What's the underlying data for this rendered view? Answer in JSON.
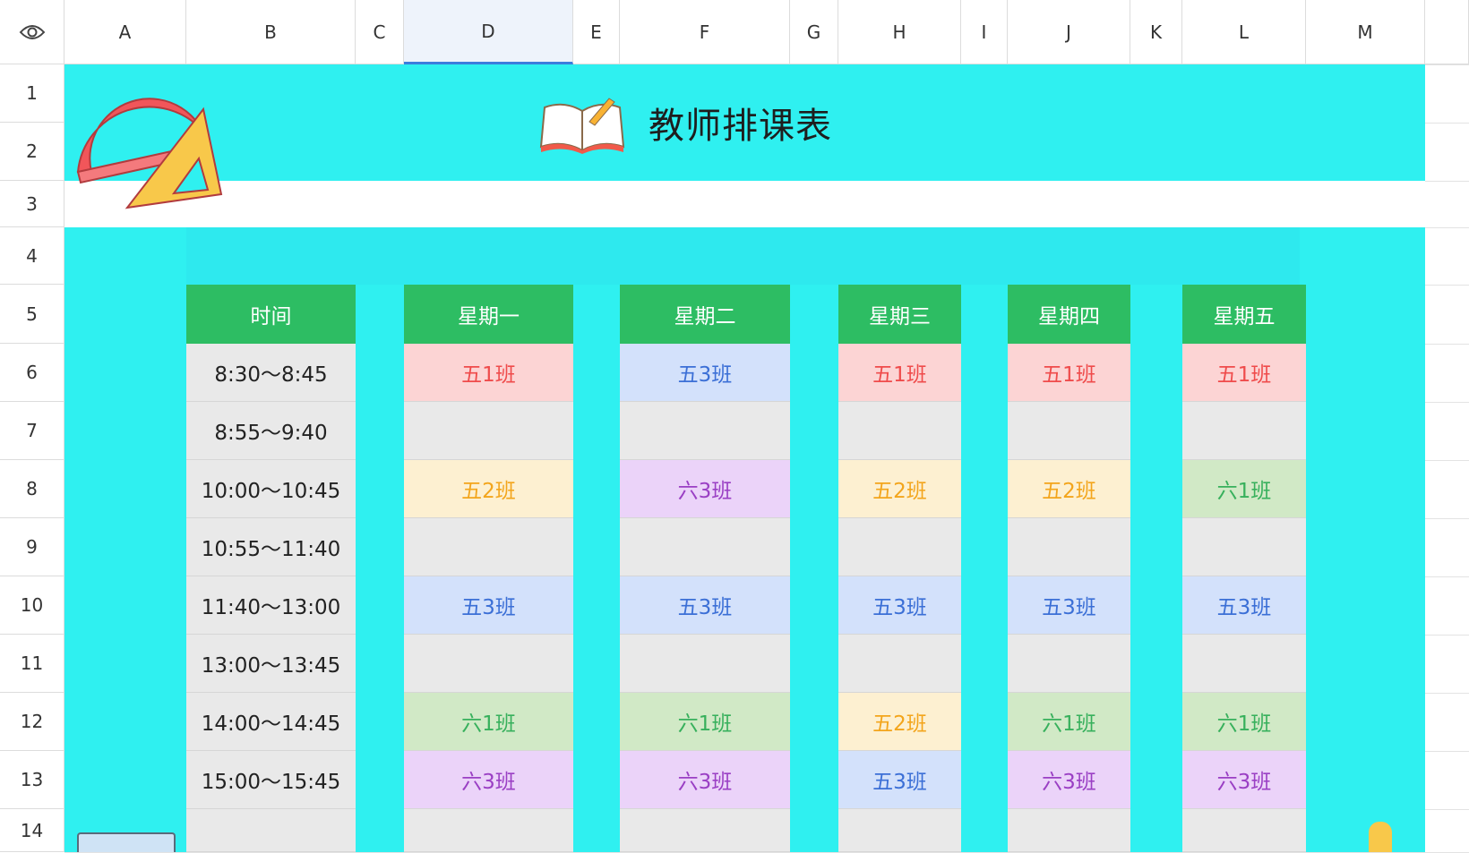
{
  "toolbar": {
    "view_icon": "eye-icon"
  },
  "columns": [
    "A",
    "B",
    "C",
    "D",
    "E",
    "F",
    "G",
    "H",
    "I",
    "J",
    "K",
    "L",
    "M"
  ],
  "rows": [
    "1",
    "2",
    "3",
    "4",
    "5",
    "6",
    "7",
    "8",
    "9",
    "10",
    "11",
    "12",
    "13",
    "14"
  ],
  "sheet": {
    "title": "教师排课表",
    "headers": [
      "时间",
      "星期一",
      "星期二",
      "星期三",
      "星期四",
      "星期五"
    ],
    "times": [
      "8:30～8:45",
      "8:55～9:40",
      "10:00～10:45",
      "10:55～11:40",
      "11:40～13:00",
      "13:00～13:45",
      "14:00～14:45",
      "15:00～15:45",
      ""
    ],
    "schedule": [
      [
        {
          "t": "五1班",
          "c": "red"
        },
        {
          "t": "五3班",
          "c": "blue"
        },
        {
          "t": "五1班",
          "c": "red"
        },
        {
          "t": "五1班",
          "c": "red"
        },
        {
          "t": "五1班",
          "c": "red"
        }
      ],
      [
        {
          "t": "",
          "c": "empty"
        },
        {
          "t": "",
          "c": "empty"
        },
        {
          "t": "",
          "c": "empty"
        },
        {
          "t": "",
          "c": "empty"
        },
        {
          "t": "",
          "c": "empty"
        }
      ],
      [
        {
          "t": "五2班",
          "c": "yellow"
        },
        {
          "t": "六3班",
          "c": "purple"
        },
        {
          "t": "五2班",
          "c": "yellow"
        },
        {
          "t": "五2班",
          "c": "yellow"
        },
        {
          "t": "六1班",
          "c": "green"
        }
      ],
      [
        {
          "t": "",
          "c": "empty"
        },
        {
          "t": "",
          "c": "empty"
        },
        {
          "t": "",
          "c": "empty"
        },
        {
          "t": "",
          "c": "empty"
        },
        {
          "t": "",
          "c": "empty"
        }
      ],
      [
        {
          "t": "五3班",
          "c": "blue"
        },
        {
          "t": "五3班",
          "c": "blue"
        },
        {
          "t": "五3班",
          "c": "blue"
        },
        {
          "t": "五3班",
          "c": "blue"
        },
        {
          "t": "五3班",
          "c": "blue"
        }
      ],
      [
        {
          "t": "",
          "c": "empty"
        },
        {
          "t": "",
          "c": "empty"
        },
        {
          "t": "",
          "c": "empty"
        },
        {
          "t": "",
          "c": "empty"
        },
        {
          "t": "",
          "c": "empty"
        }
      ],
      [
        {
          "t": "六1班",
          "c": "green"
        },
        {
          "t": "六1班",
          "c": "green"
        },
        {
          "t": "五2班",
          "c": "yellow"
        },
        {
          "t": "六1班",
          "c": "green"
        },
        {
          "t": "六1班",
          "c": "green"
        }
      ],
      [
        {
          "t": "六3班",
          "c": "purple"
        },
        {
          "t": "六3班",
          "c": "purple"
        },
        {
          "t": "五3班",
          "c": "blue"
        },
        {
          "t": "六3班",
          "c": "purple"
        },
        {
          "t": "六3班",
          "c": "purple"
        }
      ],
      [
        {
          "t": "",
          "c": "empty"
        },
        {
          "t": "",
          "c": "empty"
        },
        {
          "t": "",
          "c": "empty"
        },
        {
          "t": "",
          "c": "empty"
        },
        {
          "t": "",
          "c": "empty"
        }
      ]
    ]
  },
  "colors": {
    "band": "#2ff0f0",
    "header": "#2dbd63",
    "selected_col": "#3b7ddd"
  }
}
